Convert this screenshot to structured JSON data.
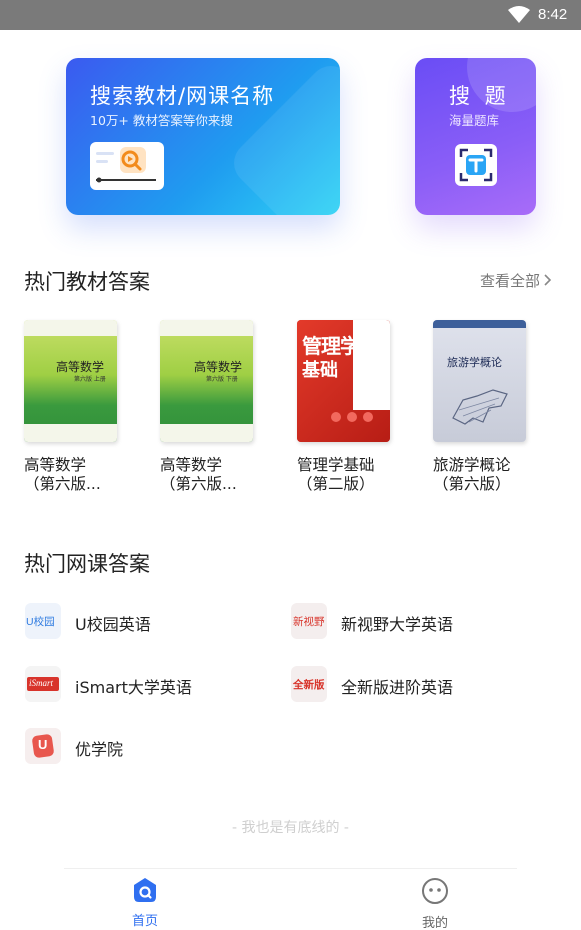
{
  "status_bar": {
    "time": "8:42"
  },
  "search_card": {
    "title": "搜索教材/网课名称",
    "subtitle": "10万+ 教材答案等你来搜"
  },
  "photo_card": {
    "title": "搜 题",
    "subtitle": "海量题库"
  },
  "textbooks": {
    "heading": "热门教材答案",
    "see_all": "查看全部",
    "items": [
      {
        "name_line1": "高等数学",
        "name_line2": "（第六版...",
        "cover_title": "高等数学",
        "cover_sub": "第六版 上册"
      },
      {
        "name_line1": "高等数学",
        "name_line2": "（第六版...",
        "cover_title": "高等数学",
        "cover_sub": "第六版 下册"
      },
      {
        "name_line1": "管理学基础",
        "name_line2": "（第二版）",
        "cover_title": "管理学",
        "cover_title2": "基础"
      },
      {
        "name_line1": "旅游学概论",
        "name_line2": "（第六版）",
        "cover_title": "旅游学概论"
      }
    ]
  },
  "courses": {
    "heading": "热门网课答案",
    "items": [
      {
        "name": "U校园英语",
        "logo_text": "U校园"
      },
      {
        "name": "新视野大学英语",
        "logo_text": "新视野"
      },
      {
        "name": "iSmart大学英语",
        "logo_text": "iSmart"
      },
      {
        "name": "全新版进阶英语",
        "logo_text": "全新版"
      },
      {
        "name": "优学院",
        "logo_text": "U"
      }
    ]
  },
  "footer_note": "- 我也是有底线的 -",
  "tabs": [
    {
      "label": "首页",
      "active": true
    },
    {
      "label": "我的",
      "active": false
    }
  ],
  "colors": {
    "accent": "#2f6ff0",
    "inactive": "#888888"
  }
}
